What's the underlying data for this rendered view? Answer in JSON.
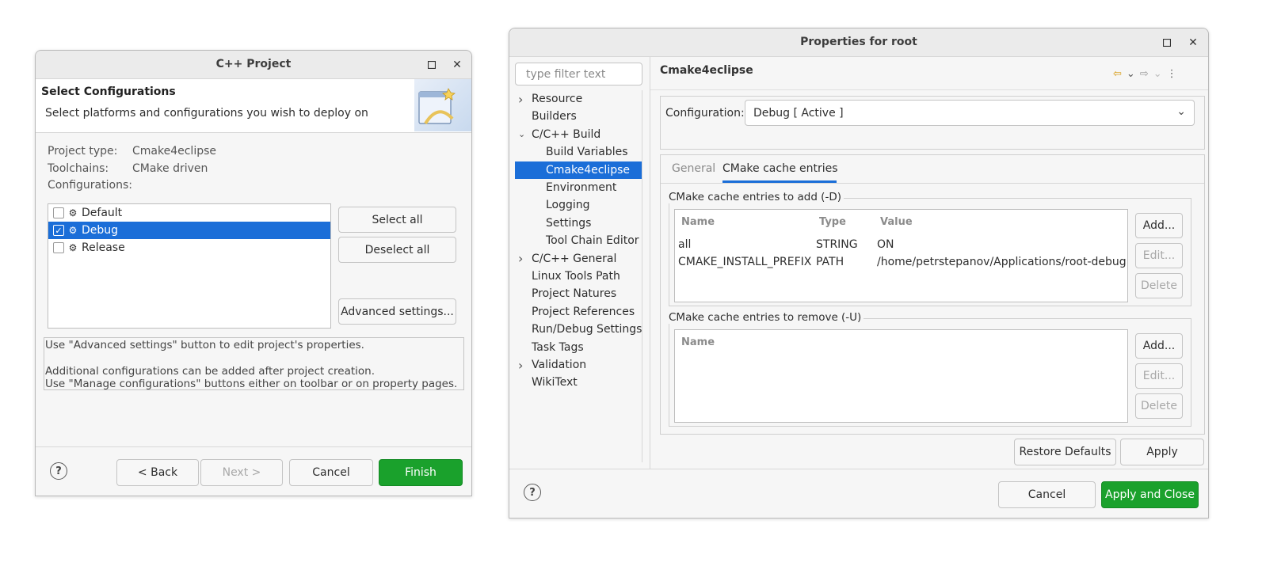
{
  "wizard": {
    "title": "C++ Project",
    "heading": "Select Configurations",
    "subheading": "Select platforms and configurations you wish to deploy on",
    "project_type_label": "Project type:",
    "project_type_value": "Cmake4eclipse",
    "toolchains_label": "Toolchains:",
    "toolchains_value": "CMake driven",
    "configurations_label": "Configurations:",
    "configs": [
      {
        "label": "Default",
        "checked": false
      },
      {
        "label": "Debug",
        "checked": true
      },
      {
        "label": "Release",
        "checked": false
      }
    ],
    "select_all": "Select all",
    "deselect_all": "Deselect all",
    "advanced_settings": "Advanced settings...",
    "info_line1": "Use \"Advanced settings\" button to edit project's properties.",
    "info_line2": "Additional configurations can be added after project creation.",
    "info_line3": "Use \"Manage configurations\" buttons either on toolbar or on property pages.",
    "help": "?",
    "back": "< Back",
    "next": "Next >",
    "cancel": "Cancel",
    "finish": "Finish"
  },
  "props": {
    "title": "Properties for root",
    "filter_placeholder": "type filter text",
    "tree": [
      {
        "label": "Resource",
        "expandable": true
      },
      {
        "label": "Builders"
      },
      {
        "label": "C/C++ Build",
        "expanded": true
      },
      {
        "label": "Build Variables",
        "child": true
      },
      {
        "label": "Cmake4eclipse",
        "child": true,
        "selected": true
      },
      {
        "label": "Environment",
        "child": true
      },
      {
        "label": "Logging",
        "child": true
      },
      {
        "label": "Settings",
        "child": true
      },
      {
        "label": "Tool Chain Editor",
        "child": true
      },
      {
        "label": "C/C++ General",
        "expandable": true
      },
      {
        "label": "Linux Tools Path"
      },
      {
        "label": "Project Natures"
      },
      {
        "label": "Project References"
      },
      {
        "label": "Run/Debug Settings"
      },
      {
        "label": "Task Tags"
      },
      {
        "label": "Validation",
        "expandable": true
      },
      {
        "label": "WikiText"
      }
    ],
    "page_title": "Cmake4eclipse",
    "configuration_label": "Configuration:",
    "configuration_value": "Debug  [ Active ]",
    "tab_general": "General",
    "tab_cache": "CMake cache entries",
    "add_group_label": "CMake cache entries to add (-D)",
    "columns": [
      "Name",
      "Type",
      "Value"
    ],
    "entries": [
      {
        "name": "all",
        "type": "STRING",
        "value": "ON"
      },
      {
        "name": "CMAKE_INSTALL_PREFIX",
        "type": "PATH",
        "value": "/home/petrstepanov/Applications/root-debug"
      }
    ],
    "remove_group_label": "CMake cache entries to remove (-U)",
    "remove_column": "Name",
    "add_btn": "Add...",
    "edit_btn": "Edit...",
    "delete_btn": "Delete",
    "restore_defaults": "Restore Defaults",
    "apply": "Apply",
    "cancel": "Cancel",
    "apply_close": "Apply and Close",
    "help": "?"
  }
}
